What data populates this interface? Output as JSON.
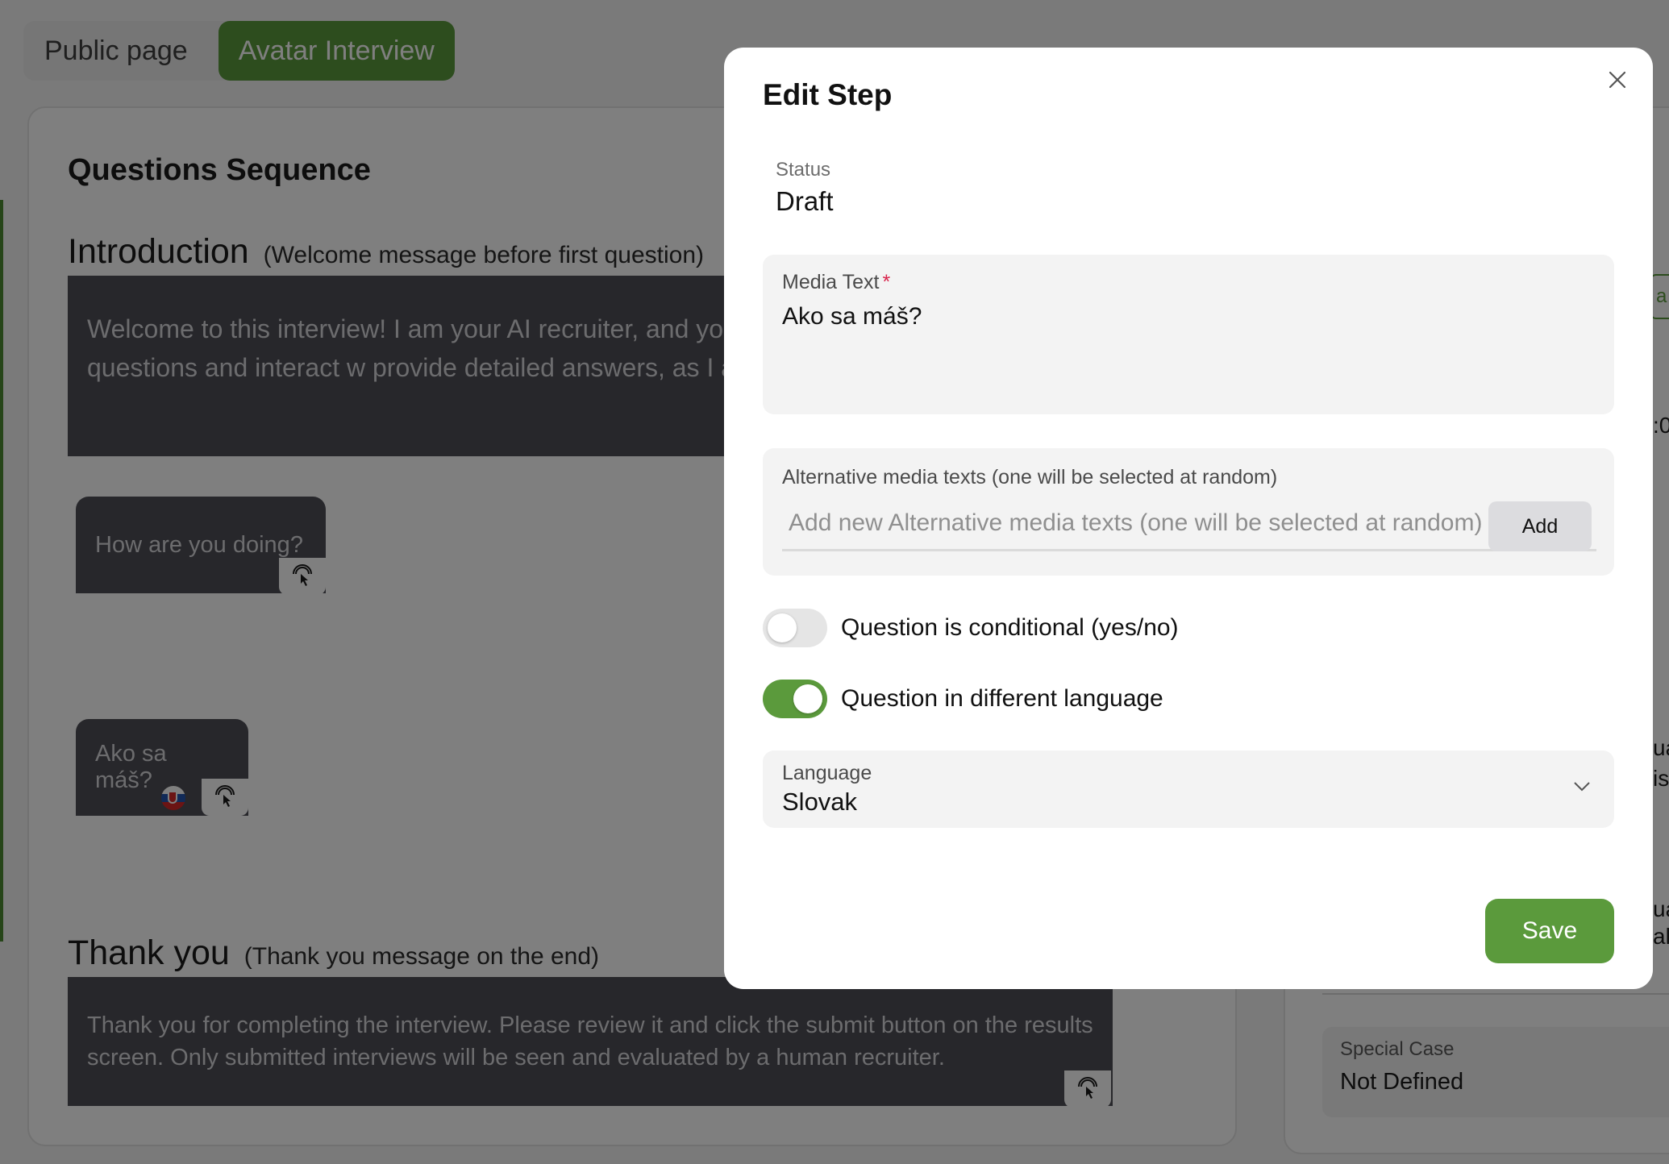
{
  "tabs": [
    {
      "label": "Public page",
      "active": false
    },
    {
      "label": "Avatar Interview",
      "active": true
    }
  ],
  "sequence": {
    "title": "Questions Sequence",
    "introduction": {
      "heading": "Introduction",
      "subheading": "(Welcome message before first question)",
      "text": "Welcome to this interview! I am your AI recruiter, and you. Please feel free to ask questions and interact w provide detailed answers, as I am keen to get to know"
    },
    "questions": [
      {
        "text": "How are you doing?",
        "flag": null
      },
      {
        "text": "Ako sa máš?",
        "flag": "slovakia-flag"
      }
    ],
    "thank_you": {
      "heading": "Thank you",
      "subheading": "(Thank you message on the end)",
      "text": "Thank you for completing the interview. Please review it and click the submit button on the results screen. Only submitted interviews will be seen and evaluated by a human recruiter."
    }
  },
  "side_panel": {
    "special_case_label": "Special Case",
    "special_case_value": "Not Defined",
    "fragments": [
      "a",
      ":0",
      "ua",
      "is",
      "ua",
      "al"
    ]
  },
  "modal": {
    "title": "Edit Step",
    "status_label": "Status",
    "status_value": "Draft",
    "media_text_label": "Media Text",
    "media_text_required": "*",
    "media_text_value": "Ako sa máš?",
    "alt_label": "Alternative media texts (one will be selected at random)",
    "alt_placeholder": "Add new Alternative media texts (one will be selected at random)",
    "add_label": "Add",
    "conditional_label": "Question is conditional (yes/no)",
    "conditional_on": false,
    "different_language_label": "Question in different language",
    "different_language_on": true,
    "language_label": "Language",
    "language_value": "Slovak",
    "save_label": "Save"
  },
  "colors": {
    "accent": "#5b9a3c",
    "dark_block": "#4f4f57",
    "required": "#d8234b"
  },
  "icons": {
    "tap": "tap-gesture-icon",
    "close": "close-icon",
    "dropdown": "chevron-down-icon"
  }
}
